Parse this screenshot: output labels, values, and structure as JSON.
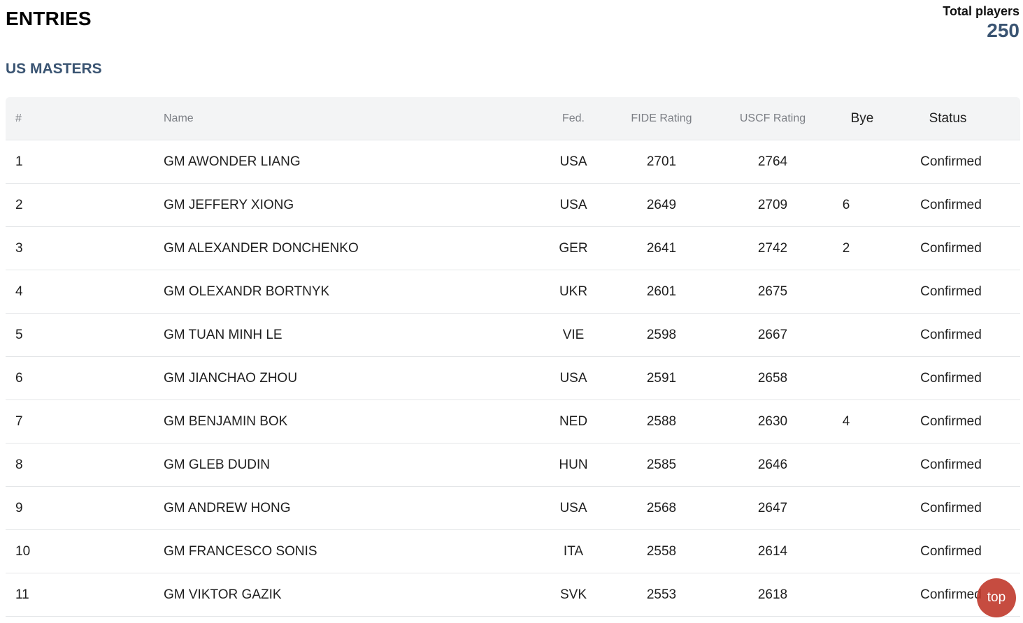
{
  "header": {
    "title": "ENTRIES",
    "total_label": "Total players",
    "total_value": "250"
  },
  "section": {
    "title": "US MASTERS"
  },
  "table": {
    "columns": {
      "num": "#",
      "name": "Name",
      "fed": "Fed.",
      "fide": "FIDE Rating",
      "uscf": "USCF Rating",
      "bye": "Bye",
      "status": "Status"
    },
    "rows": [
      {
        "num": "1",
        "name": "GM AWONDER LIANG",
        "fed": "USA",
        "fide": "2701",
        "uscf": "2764",
        "bye": "",
        "status": "Confirmed"
      },
      {
        "num": "2",
        "name": "GM JEFFERY XIONG",
        "fed": "USA",
        "fide": "2649",
        "uscf": "2709",
        "bye": "6",
        "status": "Confirmed"
      },
      {
        "num": "3",
        "name": "GM ALEXANDER DONCHENKO",
        "fed": "GER",
        "fide": "2641",
        "uscf": "2742",
        "bye": "2",
        "status": "Confirmed"
      },
      {
        "num": "4",
        "name": "GM OLEXANDR BORTNYK",
        "fed": "UKR",
        "fide": "2601",
        "uscf": "2675",
        "bye": "",
        "status": "Confirmed"
      },
      {
        "num": "5",
        "name": "GM TUAN MINH LE",
        "fed": "VIE",
        "fide": "2598",
        "uscf": "2667",
        "bye": "",
        "status": "Confirmed"
      },
      {
        "num": "6",
        "name": "GM JIANCHAO ZHOU",
        "fed": "USA",
        "fide": "2591",
        "uscf": "2658",
        "bye": "",
        "status": "Confirmed"
      },
      {
        "num": "7",
        "name": "GM BENJAMIN BOK",
        "fed": "NED",
        "fide": "2588",
        "uscf": "2630",
        "bye": "4",
        "status": "Confirmed"
      },
      {
        "num": "8",
        "name": "GM GLEB DUDIN",
        "fed": "HUN",
        "fide": "2585",
        "uscf": "2646",
        "bye": "",
        "status": "Confirmed"
      },
      {
        "num": "9",
        "name": "GM ANDREW HONG",
        "fed": "USA",
        "fide": "2568",
        "uscf": "2647",
        "bye": "",
        "status": "Confirmed"
      },
      {
        "num": "10",
        "name": "GM FRANCESCO SONIS",
        "fed": "ITA",
        "fide": "2558",
        "uscf": "2614",
        "bye": "",
        "status": "Confirmed"
      },
      {
        "num": "11",
        "name": "GM VIKTOR GAZIK",
        "fed": "SVK",
        "fide": "2553",
        "uscf": "2618",
        "bye": "",
        "status": "Confirmed"
      }
    ]
  },
  "scroll_top": {
    "label": "top",
    "color": "#c0392b"
  }
}
